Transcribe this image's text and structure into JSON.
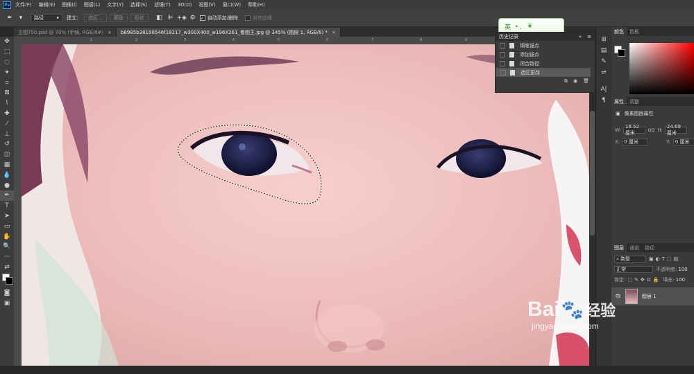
{
  "app": {
    "logo": "Ps"
  },
  "menu": [
    "文件(F)",
    "编辑(E)",
    "图像(I)",
    "图层(L)",
    "文字(Y)",
    "选择(S)",
    "滤镜(T)",
    "3D(D)",
    "视图(V)",
    "窗口(W)",
    "帮助(H)"
  ],
  "options": {
    "mode": "路径",
    "build_label": "建立：",
    "btn_selection": "选区...",
    "btn_mask": "蒙版",
    "btn_shape": "形状",
    "auto_add": "自动添加/删除",
    "align_edges": "对齐边缘"
  },
  "tabs": [
    {
      "label": "主图750.psd @ 70% (手镜, RGB/8#)",
      "close": "×",
      "active": false
    },
    {
      "label": "b8985b38190546f18217_w300X400_w196X261_看图王.jpg @ 345% (图层 1, RGB/8) *",
      "close": "×",
      "active": true
    }
  ],
  "ruler_ticks": [
    "1",
    "2",
    "3",
    "4",
    "5",
    "6",
    "7",
    "8",
    "9",
    "10",
    "11"
  ],
  "history": {
    "title": "历史记录",
    "menu_glyph": "≡",
    "collapse_glyph": "»",
    "items": [
      "钢笔锚点",
      "添加锚点",
      "闭合路径",
      "选区更改"
    ],
    "selected_index": 3
  },
  "ime": {
    "label": "英",
    "extra": "• ,"
  },
  "color_panel": {
    "tabs": [
      "颜色",
      "色板"
    ]
  },
  "properties": {
    "tabs": [
      "属性",
      "调整"
    ],
    "subtitle": "像素图层属性",
    "w_label": "W:",
    "w_value": "18.52 厘米",
    "link": "GO",
    "h_label": "H:",
    "h_value": "24.69 厘米",
    "x_label": "X:",
    "x_value": "0 厘米",
    "y_label": "Y:",
    "y_value": "0 厘米"
  },
  "layers": {
    "tabs": [
      "图层",
      "通道",
      "路径"
    ],
    "filter": "类型",
    "blend_mode": "正常",
    "opacity_label": "不透明度:",
    "opacity_value": "100",
    "lock_label": "锁定:",
    "fill_label": "填充:",
    "fill_value": "100",
    "layer_name": "图层 1"
  },
  "watermark": {
    "brand": "Bai",
    "brand2": "经验",
    "url": "jingyan.baidu.com"
  },
  "colors": {
    "selection": "#111111",
    "accent": "#2fa3f7"
  }
}
